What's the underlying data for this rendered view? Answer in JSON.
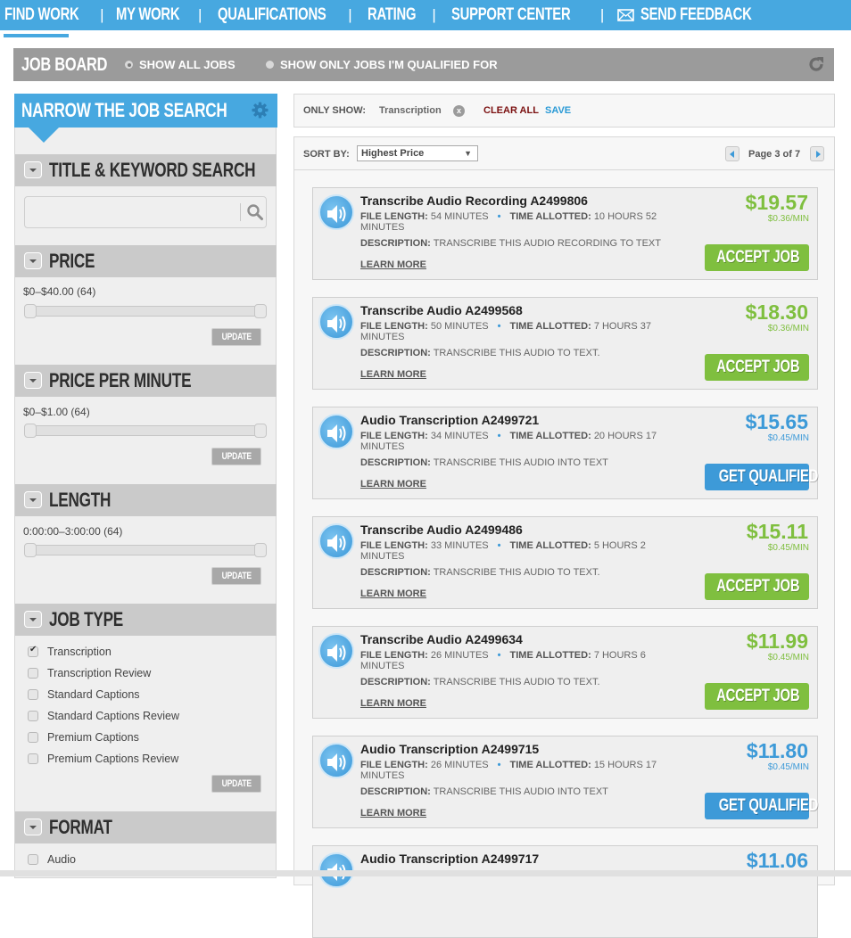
{
  "nav": {
    "items": [
      "FIND WORK",
      "MY WORK",
      "QUALIFICATIONS",
      "RATING",
      "SUPPORT CENTER",
      "SEND FEEDBACK"
    ],
    "separator": "|",
    "active": "FIND WORK",
    "accent": "#47a8e0"
  },
  "jobboard": {
    "title": "JOB BOARD",
    "options": [
      {
        "label": "SHOW ALL JOBS",
        "selected": true
      },
      {
        "label": "SHOW ONLY JOBS I'M QUALIFIED FOR",
        "selected": false
      }
    ],
    "refresh_icon": "refresh-icon"
  },
  "sidebar": {
    "title": "NARROW THE JOB SEARCH",
    "settings_icon": "gear-icon",
    "sections": {
      "keyword": {
        "label": "TITLE & KEYWORD SEARCH",
        "value": "",
        "placeholder": ""
      },
      "price": {
        "label": "PRICE",
        "range": "$0–$40.00  (64)",
        "min_value": 0,
        "max_value": 40.0,
        "update": "UPDATE"
      },
      "ppm": {
        "label": "PRICE PER MINUTE",
        "range": "$0–$1.00  (64)",
        "min_value": 0,
        "max_value": 1.0,
        "update": "UPDATE"
      },
      "length": {
        "label": "LENGTH",
        "range": "0:00:00–3:00:00 (64)",
        "min_value": "0:00:00",
        "max_value": "3:00:00",
        "update": "UPDATE"
      },
      "jobtype": {
        "label": "JOB TYPE",
        "options": [
          {
            "label": "Transcription",
            "checked": true
          },
          {
            "label": "Transcription Review",
            "checked": false
          },
          {
            "label": "Standard Captions",
            "checked": false
          },
          {
            "label": "Standard Captions Review",
            "checked": false
          },
          {
            "label": "Premium Captions",
            "checked": false
          },
          {
            "label": "Premium Captions Review",
            "checked": false
          }
        ],
        "update": "UPDATE"
      },
      "format": {
        "label": "FORMAT",
        "options": [
          {
            "label": "Audio",
            "checked": false
          }
        ]
      }
    }
  },
  "filters": {
    "only_show_label": "ONLY SHOW:",
    "chip": "Transcription",
    "chip_remove": "x",
    "clear_all": "CLEAR ALL",
    "save": "SAVE"
  },
  "sort": {
    "label": "SORT BY:",
    "selected": "Highest Price",
    "arrow": "▼",
    "page_label": "Page 3 of 7",
    "page": 3,
    "total_pages": 7
  },
  "labels": {
    "file_length": "FILE LENGTH:",
    "time_allotted": "TIME ALLOTTED:",
    "description": "DESCRIPTION:",
    "learn_more": "LEARN MORE",
    "bullet": "•"
  },
  "jobs": [
    {
      "title": "Transcribe Audio Recording A2499806",
      "file_length": "54 MINUTES",
      "time_allotted": "10 HOURS 52 MINUTES",
      "description": "TRANSCRIBE THIS AUDIO RECORDING TO TEXT",
      "price": "$19.57",
      "ppm": "$0.36/MIN",
      "action": "ACCEPT JOB",
      "qualified": true
    },
    {
      "title": "Transcribe Audio A2499568",
      "file_length": "50 MINUTES",
      "time_allotted": "7 HOURS 37 MINUTES",
      "description": "TRANSCRIBE THIS AUDIO TO TEXT.",
      "price": "$18.30",
      "ppm": "$0.36/MIN",
      "action": "ACCEPT JOB",
      "qualified": true
    },
    {
      "title": "Audio Transcription A2499721",
      "file_length": "34 MINUTES",
      "time_allotted": "20 HOURS 17 MINUTES",
      "description": "TRANSCRIBE THIS AUDIO INTO TEXT",
      "price": "$15.65",
      "ppm": "$0.45/MIN",
      "action": "GET QUALIFIED",
      "qualified": false
    },
    {
      "title": "Transcribe Audio A2499486",
      "file_length": "33 MINUTES",
      "time_allotted": "5 HOURS 2 MINUTES",
      "description": "TRANSCRIBE THIS AUDIO TO TEXT.",
      "price": "$15.11",
      "ppm": "$0.45/MIN",
      "action": "ACCEPT JOB",
      "qualified": true
    },
    {
      "title": "Transcribe Audio A2499634",
      "file_length": "26 MINUTES",
      "time_allotted": "7 HOURS 6 MINUTES",
      "description": "TRANSCRIBE THIS AUDIO TO TEXT.",
      "price": "$11.99",
      "ppm": "$0.45/MIN",
      "action": "ACCEPT JOB",
      "qualified": true
    },
    {
      "title": "Audio Transcription A2499715",
      "file_length": "26 MINUTES",
      "time_allotted": "15 HOURS 17 MINUTES",
      "description": "TRANSCRIBE THIS AUDIO INTO TEXT",
      "price": "$11.80",
      "ppm": "$0.45/MIN",
      "action": "GET QUALIFIED",
      "qualified": false
    },
    {
      "title": "Audio Transcription A2499717",
      "price": "$11.06",
      "qualified": false
    }
  ],
  "colors": {
    "accent_blue": "#47a8e0",
    "qualified_green": "#7fbf3f",
    "unqualified_blue": "#3d9ad8",
    "clear_all": "#7b1010"
  }
}
